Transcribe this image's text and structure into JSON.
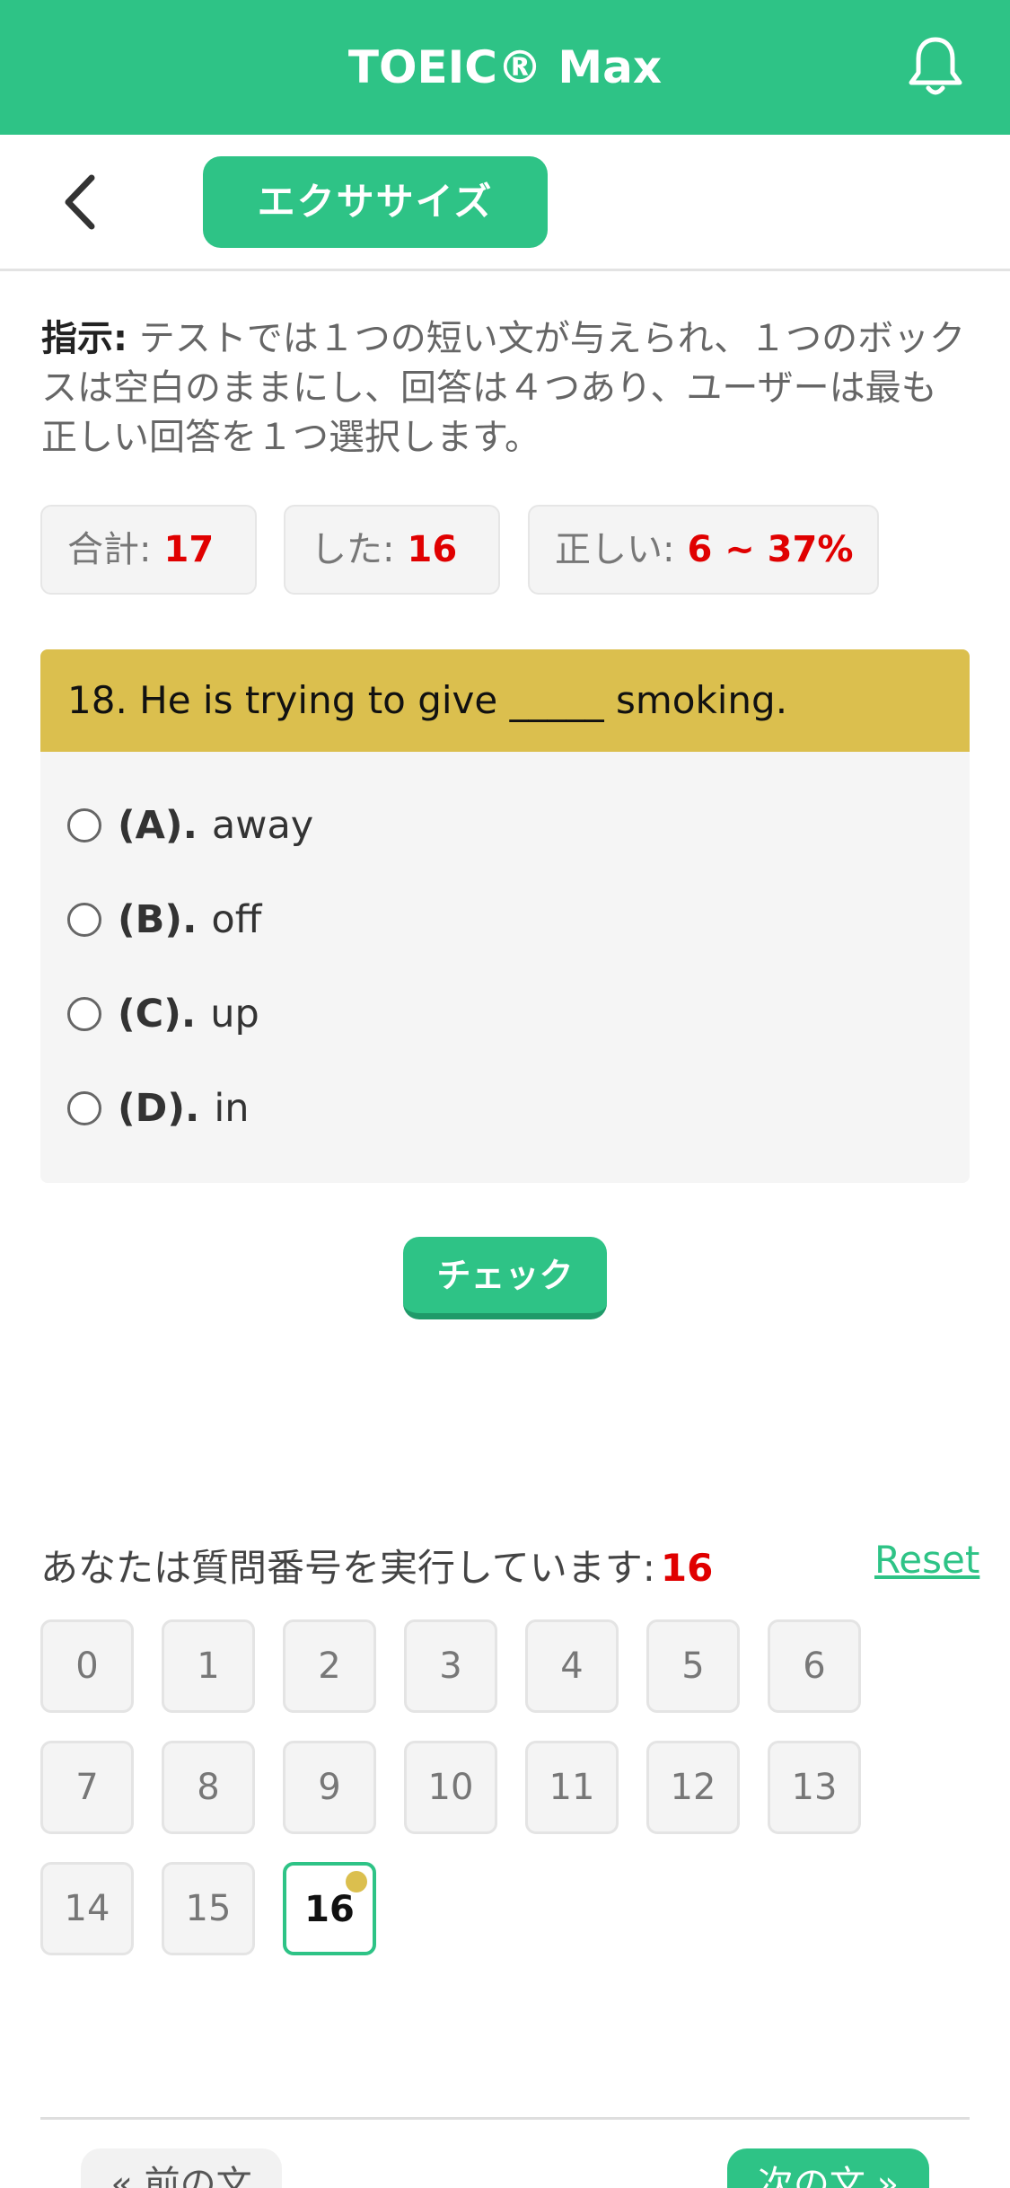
{
  "header": {
    "title": "TOEIC® Max",
    "icon": "bell-icon"
  },
  "nav": {
    "back_icon": "chevron-left-icon",
    "tab_label": "エクササイズ"
  },
  "instructions": {
    "label": "指示:",
    "text": " テストでは１つの短い文が与えられ、１つのボックスは空白のままにし、回答は４つあり、ユーザーは最も正しい回答を１つ選択します。"
  },
  "stats": {
    "total_label": "合計:",
    "total_value": "17",
    "done_label": "した:",
    "done_value": "16",
    "correct_label": "正しい:",
    "correct_value": "6 ~ 37%"
  },
  "question": {
    "text": "18. He is trying to give _____ smoking.",
    "options": [
      {
        "letter": "(A).",
        "text": "away"
      },
      {
        "letter": "(B).",
        "text": "off"
      },
      {
        "letter": "(C).",
        "text": "up"
      },
      {
        "letter": "(D).",
        "text": "in"
      }
    ]
  },
  "check_label": "チェック",
  "progress": {
    "label": "あなたは質問番号を実行しています:",
    "current": "16",
    "reset_label": "Reset"
  },
  "numbers": [
    "0",
    "1",
    "2",
    "3",
    "4",
    "5",
    "6",
    "7",
    "8",
    "9",
    "10",
    "11",
    "12",
    "13",
    "14",
    "15",
    "16"
  ],
  "footer": {
    "prev_label": "« 前の文",
    "next_label": "次の文 »"
  },
  "colors": {
    "accent": "#2ec386",
    "question_header": "#dbbf4e",
    "highlight": "#e00000"
  }
}
